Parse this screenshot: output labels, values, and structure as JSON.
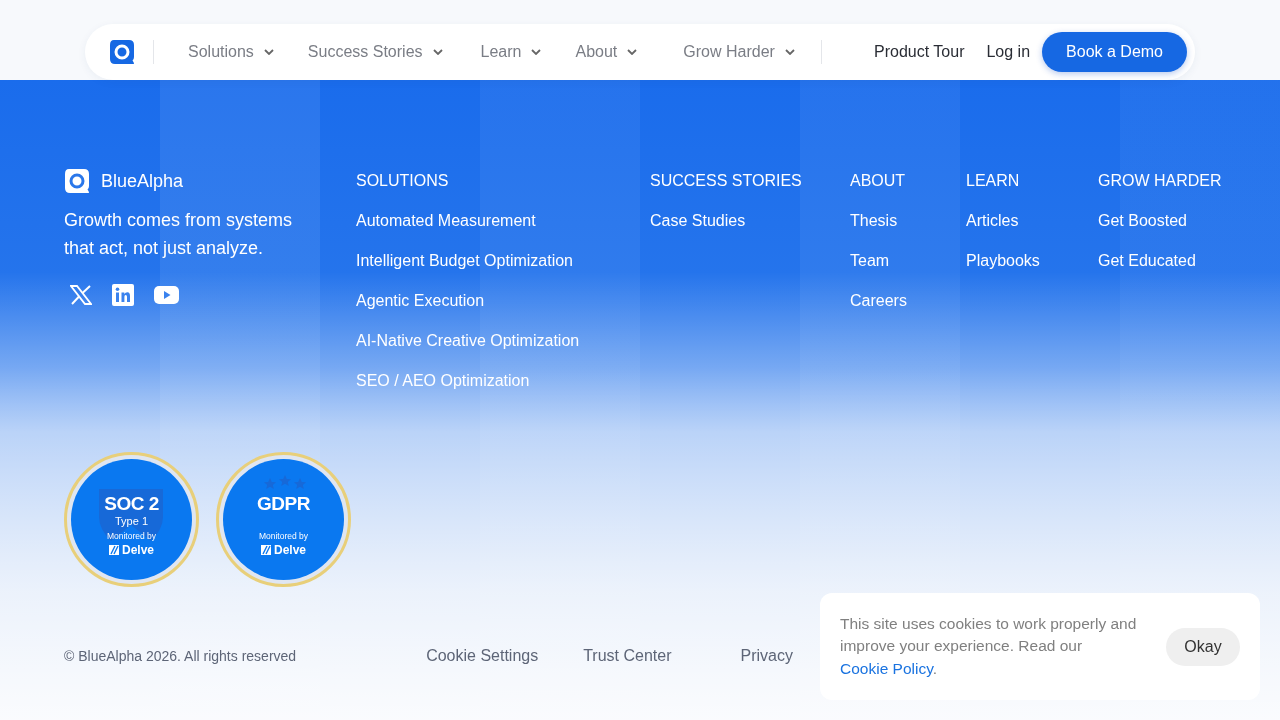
{
  "nav": {
    "menu": [
      {
        "label": "Solutions",
        "dropdown": true
      },
      {
        "label": "Success Stories",
        "dropdown": true
      },
      {
        "label": "Learn",
        "dropdown": true
      },
      {
        "label": "About",
        "dropdown": true
      },
      {
        "label": "Grow Harder",
        "dropdown": true
      }
    ],
    "links": [
      "Product Tour",
      "Log in"
    ],
    "cta": "Book a Demo"
  },
  "footer": {
    "brand": "BlueAlpha",
    "tagline": "Growth comes from systems that act, not just analyze.",
    "social": [
      {
        "kind": "x"
      },
      {
        "kind": "linkedin"
      },
      {
        "kind": "youtube"
      }
    ],
    "columns": [
      {
        "heading": "SOLUTIONS",
        "items": [
          "Automated Measurement",
          "Intelligent Budget Optimization",
          "Agentic Execution",
          "AI-Native Creative Optimization",
          "SEO / AEO Optimization"
        ]
      },
      {
        "heading": "SUCCESS STORIES",
        "items": [
          "Case Studies"
        ]
      },
      {
        "heading": "ABOUT",
        "items": [
          "Thesis",
          "Team",
          "Careers"
        ]
      },
      {
        "heading": "LEARN",
        "items": [
          "Articles",
          "Playbooks"
        ]
      },
      {
        "heading": "GROW HARDER",
        "items": [
          "Get Boosted",
          "Get Educated"
        ]
      }
    ],
    "badges": [
      {
        "kind": "soc2",
        "title": "SOC 2",
        "subtitle": "Type 1",
        "monitored": "Monitored by",
        "vendor": "Delve"
      },
      {
        "kind": "gdpr",
        "title": "GDPR",
        "monitored": "Monitored by",
        "vendor": "Delve"
      }
    ],
    "copyright": "© BlueAlpha 2026. All rights reserved",
    "legal_links": [
      "Cookie Settings",
      "Trust Center",
      "Privacy"
    ]
  },
  "cookie_banner": {
    "text": "This site uses cookies to work properly and improve your experience. Read our ",
    "link": "Cookie Policy",
    "after_link": ".",
    "button": "Okay"
  }
}
